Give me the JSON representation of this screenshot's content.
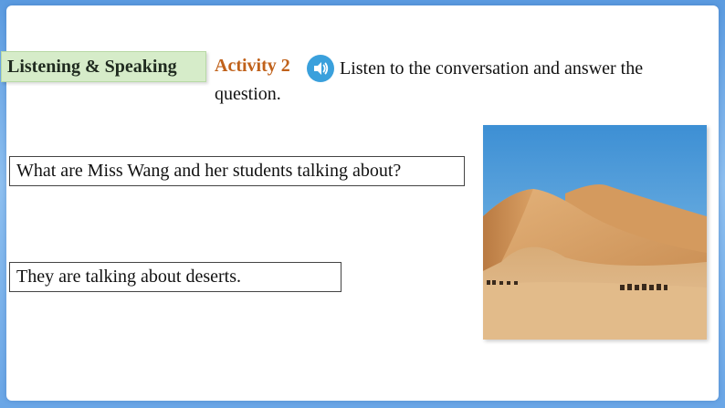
{
  "section_tag": "Listening & Speaking",
  "activity": {
    "label": "Activity 2",
    "instruction": "Listen to the conversation and answer the question."
  },
  "question": "What are Miss Wang and her students talking about?",
  "answer": "They are talking about deserts.",
  "icons": {
    "speaker": "speaker-icon"
  },
  "colors": {
    "activity_label": "#c0611a",
    "section_tag_bg": "#d6ecc9",
    "speaker_bg": "#3aa0dc"
  }
}
